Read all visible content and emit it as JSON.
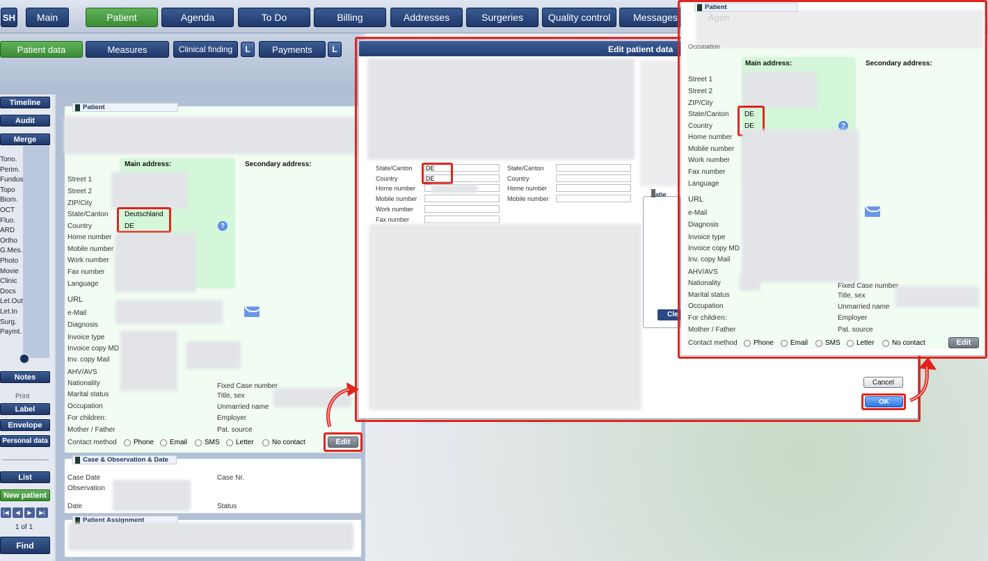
{
  "app": {
    "logo": "SH"
  },
  "topnav": [
    "Main",
    "Patient",
    "Agenda",
    "To Do",
    "Billing",
    "Addresses",
    "Surgeries",
    "Quality control",
    "Messages"
  ],
  "subnav": {
    "patient_data": "Patient data",
    "measures": "Measures",
    "clinical_finding": "Clinical finding",
    "payments": "Payments",
    "l": "L"
  },
  "sidebar": {
    "timeline": "Timeline",
    "audit": "Audit",
    "merge": "Merge",
    "tools": [
      "Tono.",
      "Perim.",
      "Fundus",
      "Topo",
      "Biom.",
      "OCT",
      "Fluo.",
      "ARD",
      "Ortho",
      "G.Mes.",
      "Photo",
      "Movie",
      "Clinic",
      "Docs",
      "Let.Out",
      "Let.In",
      "Surg.",
      "Paymt."
    ],
    "notes": "Notes",
    "print": "Print",
    "label": "Label",
    "envelope": "Envelope",
    "personal_data": "Personal data",
    "list": "List",
    "new_patient": "New patient",
    "pager": "1 of 1",
    "find": "Find"
  },
  "patient_panel": {
    "title": "Patient",
    "main_address": "Main address:",
    "secondary_address": "Secondary address:",
    "fields": [
      "Street 1",
      "Street 2",
      "ZIP/City",
      "State/Canton",
      "Country",
      "Home number",
      "Mobile number",
      "Work number",
      "Fax number",
      "Language"
    ],
    "state_value": "Deutschland",
    "country_value": "DE",
    "url": "URL",
    "email": "e-Mail",
    "diagnosis": "Diagnosis",
    "invoice_type": "Invoice type",
    "invoice_copy_md": "Invoice copy MD",
    "inv_copy_mail": "Inv. copy Mail",
    "ahv": "AHV/AVS",
    "nationality": "Nationality",
    "marital": "Marital status",
    "occupation": "Occupation",
    "for_children": "For children:",
    "mother_father": "Mother / Father",
    "fixed_case": "Fixed Case number",
    "title_sex": "Title, sex",
    "unmarried": "Unmarried name",
    "employer": "Employer",
    "pat_source": "Pat. source",
    "contact_method": "Contact method",
    "contact_options": [
      "Phone",
      "Email",
      "SMS",
      "Letter",
      "No contact"
    ],
    "edit": "Edit"
  },
  "case_panel": {
    "title": "Case & Observation & Date",
    "case_date": "Case Date",
    "observation": "Observation",
    "date": "Date",
    "case_nr": "Case Nr.",
    "status": "Status"
  },
  "assignment_panel": {
    "title": "Patient Assignment"
  },
  "edit_dialog": {
    "title": "Edit patient data",
    "fields_left": [
      "State/Canton",
      "Country",
      "Home number",
      "Mobile number",
      "Work number",
      "Fax number"
    ],
    "fields_right": [
      "State/Canton",
      "Country",
      "Home number",
      "Mobile number"
    ],
    "state_value": "DE",
    "country_value": "DE",
    "patient_mini": "Patie",
    "clear_mini": "Cle",
    "cancel": "Cancel",
    "ok": "OK"
  },
  "zoom_panel": {
    "title": "Patient",
    "ghost_tab": "Agen",
    "occupation_top": "Occupation",
    "main_address": "Main address:",
    "secondary_address": "Secondary address:",
    "fields": [
      "Street 1",
      "Street 2",
      "ZIP/City",
      "State/Canton",
      "Country",
      "Home number",
      "Mobile number",
      "Work number",
      "Fax number",
      "Language"
    ],
    "state_value": "DE",
    "country_value": "DE",
    "url": "URL",
    "email": "e-Mail",
    "diagnosis": "Diagnosis",
    "invoice_type": "Invoice type",
    "invoice_copy_md": "Invoice copy MD",
    "inv_copy_mail": "Inv. copy Mail",
    "ahv": "AHV/AVS",
    "nationality": "Nationality",
    "marital": "Marital status",
    "occupation": "Occupation",
    "for_children": "For children:",
    "mother_father": "Mother / Father",
    "fixed_case": "Fixed Case number",
    "title_sex": "Title, sex",
    "unmarried": "Unmarried name",
    "employer": "Employer",
    "pat_source": "Pat. source",
    "contact_method": "Contact method",
    "contact_options": [
      "Phone",
      "Email",
      "SMS",
      "Letter",
      "No contact"
    ],
    "edit": "Edit"
  },
  "colors": {
    "nav_blue": "#20386a",
    "active_green": "#3a8b34",
    "highlight_red": "#e1231c",
    "panel_green": "#f1fcf3"
  }
}
